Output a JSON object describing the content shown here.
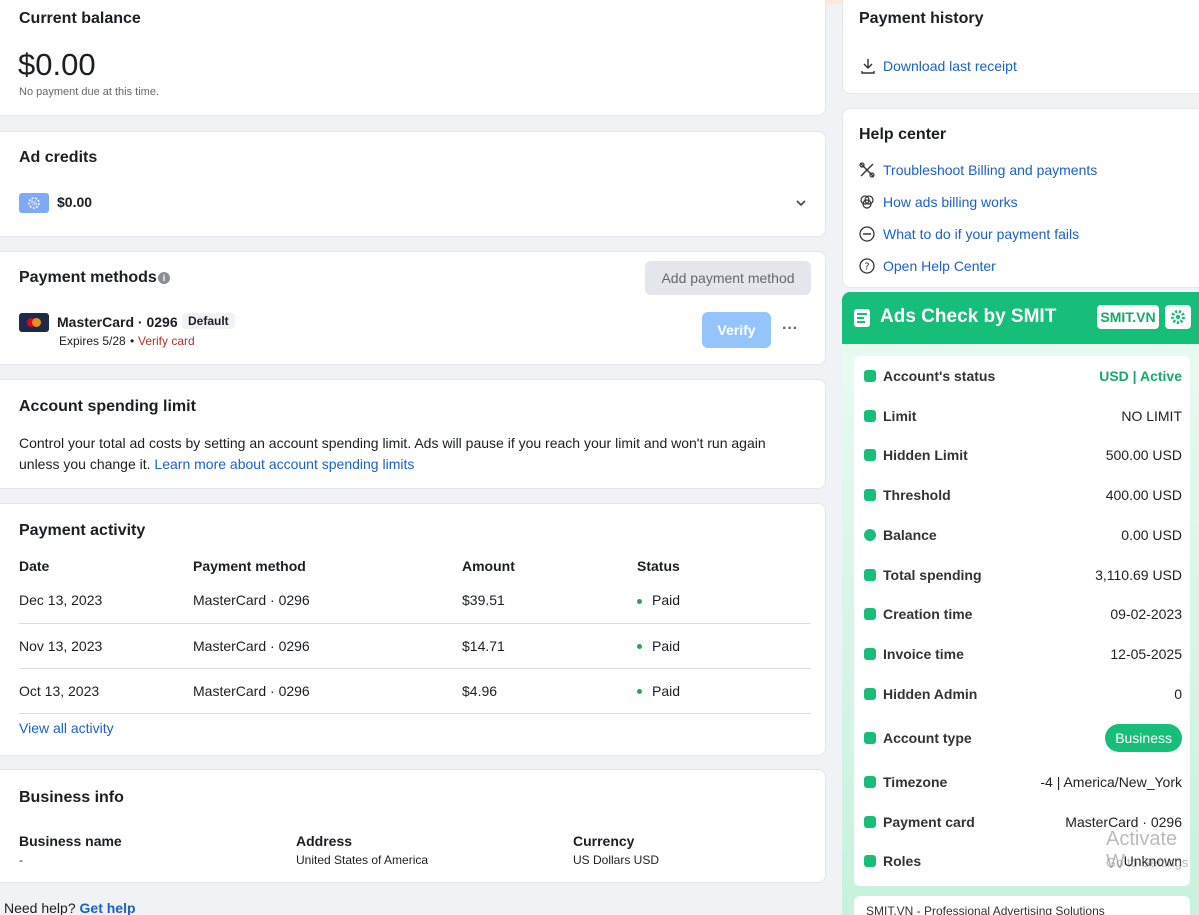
{
  "balance": {
    "title": "Current balance",
    "amount": "$0.00",
    "note": "No payment due at this time."
  },
  "credits": {
    "title": "Ad credits",
    "amount": "$0.00"
  },
  "methods": {
    "title": "Payment methods",
    "add_label": "Add payment method",
    "card_name": "MasterCard · 0296",
    "default_badge": "Default",
    "expires": "Expires 5/28",
    "verify_link": "Verify card",
    "verify_button": "Verify",
    "more": "···"
  },
  "limit": {
    "title": "Account spending limit",
    "description": "Control your total ad costs by setting an account spending limit. Ads will pause if you reach your limit and won't run again unless you change it.",
    "learn_more": "Learn more about account spending limits"
  },
  "activity": {
    "title": "Payment activity",
    "columns": [
      "Date",
      "Payment method",
      "Amount",
      "Status"
    ],
    "rows": [
      {
        "date": "Dec 13, 2023",
        "method": "MasterCard · 0296",
        "amount": "$39.51",
        "status": "Paid"
      },
      {
        "date": "Nov 13, 2023",
        "method": "MasterCard · 0296",
        "amount": "$14.71",
        "status": "Paid"
      },
      {
        "date": "Oct 13, 2023",
        "method": "MasterCard · 0296",
        "amount": "$4.96",
        "status": "Paid"
      }
    ],
    "view_all": "View all activity"
  },
  "business": {
    "title": "Business info",
    "name_label": "Business name",
    "name_value": "-",
    "address_label": "Address",
    "address_value": "United States of America",
    "currency_label": "Currency",
    "currency_value": "US Dollars USD"
  },
  "footer": {
    "need_help": "Need help?",
    "get_help": "Get help"
  },
  "history": {
    "title": "Payment history",
    "download": "Download last receipt"
  },
  "help": {
    "title": "Help center",
    "items": [
      {
        "label": "Troubleshoot Billing and payments",
        "icon": "tools-icon"
      },
      {
        "label": "How ads billing works",
        "icon": "circles-icon"
      },
      {
        "label": "What to do if your payment fails",
        "icon": "minus-circle-icon"
      },
      {
        "label": "Open Help Center",
        "icon": "question-circle-icon"
      }
    ]
  },
  "smit": {
    "title": "Ads Check by SMIT",
    "badge": "SMIT.VN",
    "rows": [
      {
        "label": "Account's status",
        "value": "USD | Active"
      },
      {
        "label": "Limit",
        "value": "NO LIMIT"
      },
      {
        "label": "Hidden Limit",
        "value": "500.00 USD"
      },
      {
        "label": "Threshold",
        "value": "400.00 USD"
      },
      {
        "label": "Balance",
        "value": "0.00 USD"
      },
      {
        "label": "Total spending",
        "value": "3,110.69 USD"
      },
      {
        "label": "Creation time",
        "value": "09-02-2023"
      },
      {
        "label": "Invoice time",
        "value": "12-05-2025"
      },
      {
        "label": "Hidden Admin",
        "value": "0"
      },
      {
        "label": "Account type",
        "value": "Business"
      },
      {
        "label": "Timezone",
        "value": "-4 | America/New_York"
      },
      {
        "label": "Payment card",
        "value": "MasterCard · 0296"
      },
      {
        "label": "Roles",
        "value": "Unknown"
      }
    ],
    "footer": "SMIT.VN - Professional Advertising Solutions"
  },
  "watermark": {
    "line1": "Activate W",
    "line2": "Go to Settings"
  },
  "colors": {
    "link": "#1a62c6",
    "smit_green": "#17be79",
    "verify_red": "#a8342c"
  }
}
